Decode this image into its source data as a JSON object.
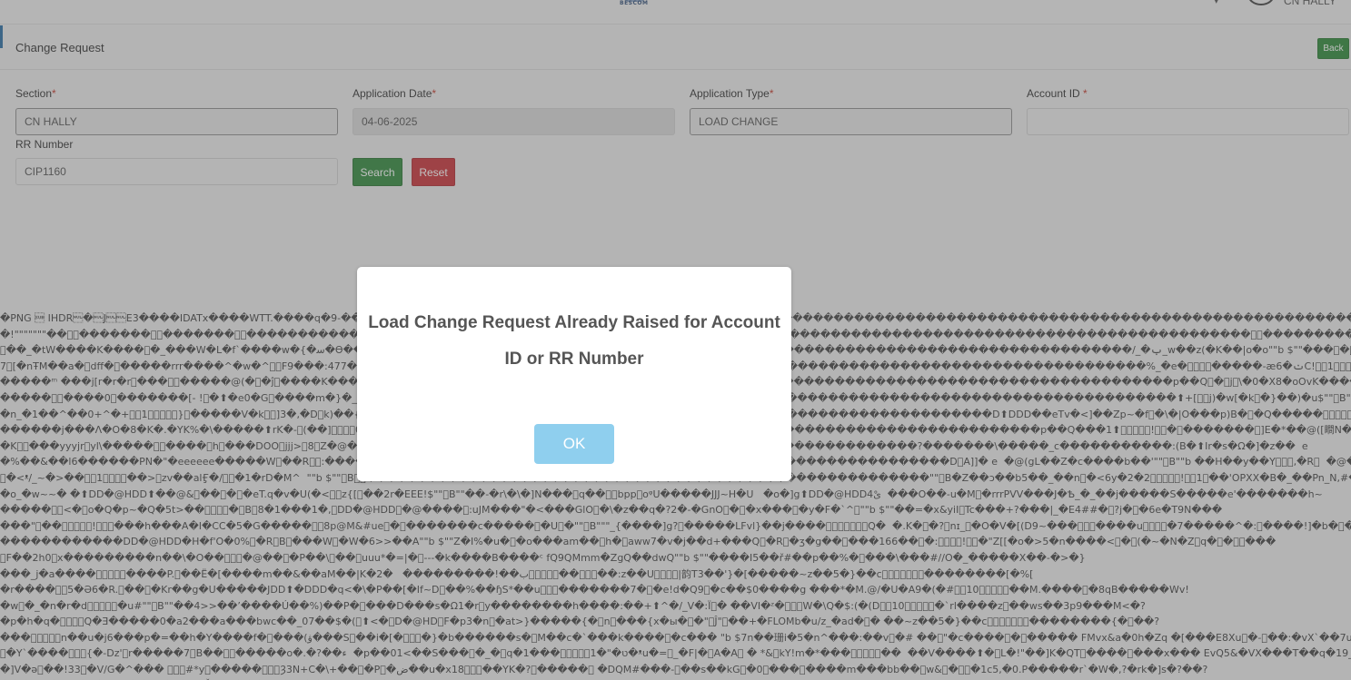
{
  "header": {
    "logo_text": "BESCOM",
    "user_name": "CN HALLY"
  },
  "card": {
    "title": "Change Request",
    "back_label": "Back"
  },
  "form": {
    "section_label": "Section",
    "section_value": "CN HALLY",
    "app_date_label": "Application Date",
    "app_date_value": "04-06-2025",
    "app_type_label": "Application Type",
    "app_type_value": "LOAD CHANGE",
    "account_label": "Account ID ",
    "account_value": "",
    "rr_label": "RR Number",
    "rr_value": "CIP1160",
    "required_mark": "*",
    "search_label": "Search",
    "reset_label": "Reset"
  },
  "dump_lines": [
    "�PNG \u001a IHDR\u0000�\u0000J\u0000\u0000E3����IDATx����WTT.����q�9-����sJ\u0000 ����������������������������������������������������������������������������������������������������������1��!�����������|\u0000��?",
    "�!\"\"\"\"\"\"\"��\u0000\u0000�������\u0000\u0000�������\u0000\u0000��������������������������������������������������������������������������������������������������\u0000\u0000����������������\u0000\u0000����������������\u0000\u0000�������",
    "\u0000��_�tW����K����\u0000�_���W�L�f`����w�{�ﺳ�Ѳ�����������������������������������������������������������������������������/_�ݕ_w��z(�K��|o�o\"\"b $\"\"���\u0000�\u0000'&&TK؛\u0000\u0000P[[��g��CC*\u0000",
    "7\u0000[�nŦM��a�\u0000dff�\u0000�����rrr����^�w�^\u0000\u0000F9���:477������������������������������������������������������������������������������%_�e�\u0000\u0000\u0000\u0000�����-æ6�ݖC!\u0000\u00001\u0000\u0000\u0000\u0000\u0000��AP�-�o\u0000ASS\u0000�\u0000;���B���'C�⬆t\u00007nTd�[(⬆ɖ�\u0000�\u0000��\u0000A?",
    "�����ᵐ ���j[r�r�r\u0000���\u0000\u0000�����@(�\u0000�ĵ\u0000����K�����?t\u0000����������������������������������������������������������������������������p��Q\u0000�\u0000j\u0000\\�0�X8�oOvK������j�����\u0000C\"\"b $\"\"Z�@([�d7M9a��ƶ_UH�O\u0000�B��B�I5�3F�ugʻ偓",
    "�����\u0000\u0000����0\u0000�������[- !\u0000�⬆�e0�G\u0000����m�}�_����)\u0000���������������������������������������������������������������������������⬆+[\u0000\u0000j)�w[�k\u0000�}��)�u$\"\"\u0000B\"\"��⬆rr\u0000��\\⬆^���\u0000�?K\u0000�?",
    "�n_�1��^��0+^�+\u0000\u00001\u0000\u0000\u0000\u0000\u0000}\u0000�����V�k\u0000\u0000]3�,�D\u0000k)��{�A������������������������������������������������������������D⬆DDD��eTv�<]��Zp~�f\u0000�\\�|O���p)B�\u0000�Q�����\u0000\u0000\u0000\u0000\u0000!\u0000\u0000�W����",
    "������j���Ʌ�O�8�K�.�YK%�\\�����⬆rK�-\u0000(��]\u0000\u0000\u0000\u0000088�����������������������������������������������������������������p��Q���1⬆\u0000\u0000\u0000\u0000\u0000!\u0000\u0000�\u0000�������\u0000]E�*��@([瞷N�\u0000V�Uq�\\x��",
    "�K\u0000\u0000���yyyjr\u0000yl\\�����\u0000\u0000����\u0000h\u0000���DOO\u0000jjj>\u00008\u0000Z�@��գ�����������������������������������������������������?�������\\�����_c�����������:(B�⬆Ir�s�Ω�]�z��  e",
    "�%��&��l6������PN�\"�eeeeee�����W\u0000��R\u0000\u0000:�������������������������������������������������������������D\u0000A]]� e  �@(gL��Z�c����b��'\"\"\u0000B\"\"b ��H��y��Y\u0000\u0000\u0000,�R\u0000  �@�",
    "\u0000�<ᵜ/_~�>��\u0000\u00001\u0000\u0000\u0000\u0000��>\u0000zv��alӺ�/\u0000\u0000�1�rD�M^  \"\"b $\"\"\u0000B\u0000\u0000�������������������������������������������������������\"\"\u0000B�Z��ɔ��b5��_��n\u0000�<6y�2�2\u0000\u0000\u0000\u0000\u0000!\u0000\u00001\u0000��'OPXX�B�_��Pn_N,#�/\u0000!\u0000\u00001\u0000\u0000\u0000\u0000\u0000�/\u0000>~�X�%\u0000Ū",
    "�o_�w~~� �⬆DD�@HDD⬆��@&\u0000��\u0000�\u0000�eT.q�v�U(�<\u0000\u0000z{[\u0000��2r�EEE!$\"\"\u0000B\"\"��-�r\\�\\�]N���\u0000q��\u0000\u0000bpp\u0000oᵠU�����JJJ~H�U   �o�]g⬆DD�@HDD4ىْ  ���O��-u�M\u0000�rrrPVV���J�Ѣ_�_��j�����S�����e'�������h~",
    "�����\u0000\u0000<�\u0000o�Q�p~�Q�5t>��\u0000\u0000\u0000\u0000�\u0000B\u00008�1���1�,\u0000DD�@HDD\u0000�@����\u0000:uJM���\"�<���GlO\u0000�\\�z��q�?2�-�GnO\u0000�\u0000�x���\u0000�y�F�`^\u0000\"\"b $\"\"��=�x&yiI\u0000Tc���+?���|_�E4##�\u0000?j�\u0000�6e�T9N���",
    "���\"\u0000��\u0000\u0000\u0000\u0000\u0000!\u0000\u0000\u0000���h���A�I�CC�5�G�����\u0000\u00008p@M&#ue\u0000�\u0000�������c�����\u0000�U\u0000�\"\"\u0000B\"\"\"_{����]g?\u0000�����LFvl}��j����\u0000\u0000\u0000\u0000\u0000\u0000\u0000Q�  �.K�\u0000�?\u0000nɪ_\u0000�O�V�[(D9~���\u0000\u0000\u0000����u\u0000\u0000\u0000\u0000�7�����^�:\u0000����!]�b�\u0000�C����-/\u0000",
    "������������DD�@HDD�H�f'O�0%\u0000�R\u0000B\u0000���W\u0000�W�6>>��A\"\"b $\"\"Z�I%�u�\u0000�o���am��\u0000h�\u0000aww7�v�j��d+���Q\u0000�R\u0000�ʒ�g��\u0000���166��\u0000�:\u0000\u0000\u0000\u0000!\u0000\u0000�\"Z[[�o�>5�n����<\u0000�\u0000(�~�N�Z\u0000q�\u0000�\u0000\u0000���",
    "\u0000F��2h0\u0000x���������n��\\�O��\u0000\u0000\u0000�@��\u0000�P��\\\u0000��\u0000uuu*�=|�\u0000---�k����B����ᶜ fQ9QMmm�ZgQ��dwQ\"\"b $\"\"����I5��ř#��p��%�\u0000���\\���#//O�_�����X��-�>�}",
    "���_j�a����\u0000\u0000\u0000\u0000\u0000����P.\u0000��Ë�[����m��&��aM��|K�2�   ���������!��ب\u0000\u0000\u0000\u0000\u0000��\u0000\u0000\u0000��:z��U\u0000\u0000\u0000\u0000|韵T3��'}�[�����~z��5�}��c\u0000\u0000\u0000\u0000\u0000\u0000\u0000��������[�%[",
    "�r����\u0000\u00005�Ə6�R.\u0000��\u0000�Kr��g�U�����JDD⬆�DDD�q<�\\�P��[�If~D\u0000��%��ɧS*��u\u0000\u0000\u0000�������7�\u0000�e!d�Q9\u0000�c��$0����g ���*�M.@/�U�A9�(�#\u0000\u000010\u0000\u0000\u0000\u0000\u0000��M.����\u0000�8qB�����Wv!",
    "�w\u0000�_�n�r�d\u0000\u0000\u0000\u0000\u0000�u#\"\"\u0000B\"\"��4>>��٬����Ú��%)��P�\u0000���D���s�Ω1�r\u0000y��������h����:��+⬆^�/_V�:Ϊ\u0000� ��VI�ᶻ�\u0000\u0000\u0000W�\\Q�$:(�(D\u0000\u000010\u0000\u0000\u0000\u0000\u0000�`rl����z\u0000��ws��3p9���M<�?",
    "�p�h�q�\u0000\u0000\u0000\u0000Q�Ǝ�����0�a2���a���bwc��_07��$�(\u0000⬆<�\u0000D�@HD\u0000F�p3�n\u0000�at>}�����{�\u0000n\u0000���{x�ы�\u0000�\"\u0000Ĵ\"\u0000��+�FLOMb�u/z_�ad�\u0000� ��~z��5�}��c\u0000\u0000\u0000\u0000\u0000\u0000\u0000��������{�\u0000��?",
    "���\u0000\u0000\u0000\u0000\u0000n��u�j6���p�=��h�Y����f�\u0000���(ۋ���S\u0000��i�[�\u0000\u0000\u0000�}�b������s�\u0000M��c�`���k����\u0000�c��� \"b $7n��珊i�5�n^���:��v\u0000�# ��\u0000\"�c����\u0000�\u0000����� FMvx&a�0h�Zq �[���E8Xu\u0000�-\u0000��:�vX`��7u\u0000�6Y�t!0q�&",
    "\u0000�Y`����\u0000\u0000\u0000{�-Dz'\u0000r�����7\u0000B��\u0000\u0000�����o�.�?��ء  �p��01<��S���\u0000�_�\u0000q�1���\u0000\u0000\u0000\u0000\u00001�\"�ט�ᵜu�=\u0000_�F|�\u0000A�A\u0000 � *&\u0000kҮ!m�*���\u0000\u0000\u0000\u0000\u0000��  ��V����⬆�\u0000L�!\"��]K�QT\u0000����\u0000���x��� EvQ5&�VX���T��q�19__U��.%\u0000!",
    "�]V�ǝ\u0000��!33\u0000�V/G�^��� \u0000\u0000\u0000#*y\u0000�����\u0000\u0000\u0000Ȝ3N+C�\\+��\u0000�P\u0000�ض��u�x18\u0000\u0000\u0000��YK�?\u0000�����\u0000 �DQM#���-\u0000��s��kG\u0000�0\u0000���\u0000����m���bb��\u0000w&\u0000�\u0000\u0000�1c5,�0.P�����r`�W�,?�rk�]s�?��?",
    "���\u0000\u0000\u0000�A\u0000\u0000�\u0000�\u0000\u0000\u0000\u0000��EU�*�\u0000�Ǚ\u0000�\u0000���3\u0000:�v1��l���\u0000u����#��ۋ�\u0000\u0000\u0000U\u0000\u0000\u0000�?�W��\u0000\u0000$5���������\u0000��C�^��\u0000���)�  �����k�Z�e'�h�\u0000��a���\u0000��\u0000\u0000�M\u0000\u0000\u00005�R@\u0000%�a�\u00007I�P�����9"
  ],
  "modal": {
    "message_line1": "Load Change Request Already Raised for Account",
    "message_line2": "ID or RR Number",
    "ok_label": "OK"
  }
}
